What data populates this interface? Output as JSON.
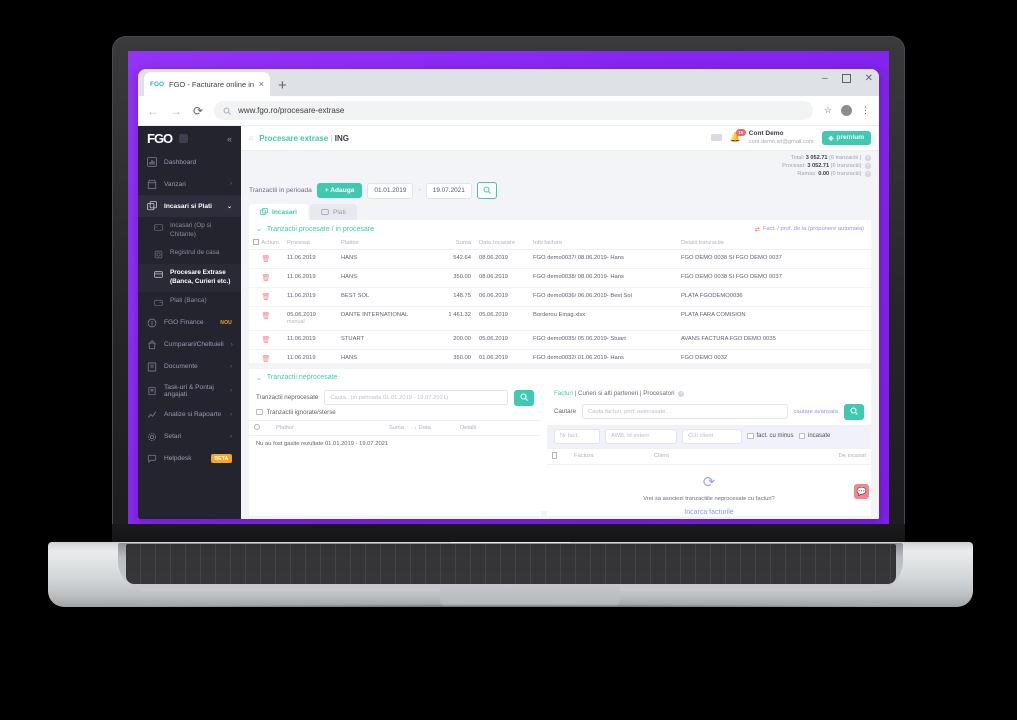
{
  "browser": {
    "tab_title": "FGO - Facturare online inte",
    "tab_close": "×",
    "new_tab": "+",
    "url": "www.fgo.ro/procesare-extrase",
    "back": "←",
    "forward": "→",
    "reload": "⟳",
    "star": "☆",
    "menu": "⋮",
    "minimize": "–",
    "close": "✕"
  },
  "sidebar": {
    "logo": "FGO",
    "collapse": "«",
    "items": [
      {
        "label": "Dashboard",
        "icon": "chart-icon",
        "chevron": ""
      },
      {
        "label": "Vanzari",
        "icon": "store-icon",
        "chevron": "›"
      },
      {
        "label": "Incasari si Plati",
        "icon": "layers-icon",
        "chevron": "⌄"
      }
    ],
    "sub_items": [
      {
        "label": "Incasari (Op si Chitante)",
        "icon": "card-icon"
      },
      {
        "label": "Registrul de casa",
        "icon": "safe-icon"
      },
      {
        "label": "Procesare Extrase (Banca, Curieri etc.)",
        "icon": "bank-icon"
      },
      {
        "label": "Plati (Banca)",
        "icon": "wallet-icon"
      }
    ],
    "items_after": [
      {
        "label": "FGO Finance",
        "icon": "coin-icon",
        "chevron": "",
        "badge": "NOU",
        "badge_style": "nou"
      },
      {
        "label": "Cumparari/Cheltuieli",
        "icon": "bag-icon",
        "chevron": "›"
      },
      {
        "label": "Documente",
        "icon": "doc-icon",
        "chevron": "›"
      },
      {
        "label": "Task-uri & Pontaj angajati",
        "icon": "badge-icon",
        "chevron": "›"
      },
      {
        "label": "Analize si Rapoarte",
        "icon": "graph-icon",
        "chevron": "›"
      },
      {
        "label": "Setari",
        "icon": "gear-icon",
        "chevron": "›"
      },
      {
        "label": "Helpdesk",
        "icon": "chat-icon",
        "chevron": "",
        "badge": "BETA",
        "badge_style": "beta"
      }
    ]
  },
  "topbar": {
    "home_icon": "home-icon",
    "breadcrumb": "Procesare extrase",
    "separator": "|",
    "bank": "ING",
    "bell_count": "19",
    "account_name": "Cont Demo",
    "account_email": "cont.demo.srl@gmail.com",
    "premium_label": "premium"
  },
  "totals": [
    {
      "label": "Total:",
      "value": "3 052.71",
      "note": "(6 tranzactii )"
    },
    {
      "label": "Procesat:",
      "value": "3 052.71",
      "note": "(6 tranzactii)"
    },
    {
      "label": "Ramas:",
      "value": "0.00",
      "note": "(0 tranzactii)"
    }
  ],
  "filterbar": {
    "label": "Tranzactii in perioada",
    "add_button": "+ Adauga",
    "date_from": "01.01.2019",
    "date_sep": "-",
    "date_to": "19.07.2021",
    "search_icon": "search-icon"
  },
  "view_tabs": [
    {
      "label": "Incasari",
      "icon": "incasari-icon",
      "active": true
    },
    {
      "label": "Plati",
      "icon": "plati-icon",
      "active": false
    }
  ],
  "processed": {
    "caret": "⌄",
    "title": "Tranzactii procesate / in procesare",
    "right_link": "Fact. / prof. de la (propunere automata)",
    "columns": [
      "Actiuni",
      "Procesat",
      "Platitor",
      "Suma",
      "Data Incasare",
      "Info factura",
      "Detalii tranzactie"
    ],
    "rows": [
      {
        "action": "delete-icon",
        "procesat": "11.06.2019",
        "procesat_sub": "",
        "platitor": "HANS",
        "suma": "542.64",
        "data": "08.06.2019",
        "info": "FGO demo0037/ 08.06.2019- Hans",
        "detalii": "FGO DEMO 0038 SI FGO DEMO 0037"
      },
      {
        "action": "delete-icon",
        "procesat": "11.06.2019",
        "procesat_sub": "",
        "platitor": "HANS",
        "suma": "350.00",
        "data": "08.06.2019",
        "info": "FGO demo0038/ 08.06.2019- Hans",
        "detalii": "FGO DEMO 0038 SI FGO DEMO 0037"
      },
      {
        "action": "delete-icon",
        "procesat": "11.06.2019",
        "procesat_sub": "",
        "platitor": "BEST SOL",
        "suma": "148.75",
        "data": "06.06.2019",
        "info": "FGO demo0036/ 06.06.2019- Best Sol",
        "detalii": "PLATA FGODEMO0036"
      },
      {
        "action": "delete-icon",
        "procesat": "05.06.2019",
        "procesat_sub": "manual",
        "platitor": "DANTE INTERNATIONAL",
        "suma": "1 461.32",
        "data": "05.06.2019",
        "info": "Borderou Emag.xlsx",
        "detalii": "PLATA FARA COMISION"
      },
      {
        "action": "delete-icon",
        "procesat": "11.06.2019",
        "procesat_sub": "",
        "platitor": "STUART",
        "suma": "200.00",
        "data": "05.06.2019",
        "info": "FGO demo0035/ 05.06.2019- Stuart",
        "detalii": "AVANS FACTURA FGO DEMO 0035"
      },
      {
        "action": "delete-icon",
        "procesat": "11.06.2019",
        "procesat_sub": "",
        "platitor": "HANS",
        "suma": "350.00",
        "data": "01.06.2019",
        "info": "FGO demo0032/ 01.06.2019- Hans",
        "detalii": "FGO DEMO 0032"
      }
    ]
  },
  "unprocessed": {
    "caret": "⌄",
    "title": "Tranzactii neprocesate",
    "search_label": "Tranzactii neprocesate",
    "search_placeholder": "Cauta...(in perioada 01.01.2019 - 19.07.2021)",
    "search_icon": "search-icon",
    "checkbox_label": "Tranzactii ignorate/sterse",
    "columns": [
      "Platitor",
      "Suma",
      "Data",
      "Detalii"
    ],
    "sort_arrow": "↓",
    "empty_message": "Nu au fost gasite rezultate 01.01.2019 - 19.07.2021"
  },
  "invoices": {
    "tab_facturi": "Facturi",
    "tab_curieri": "Curieri si alti parteneri",
    "tab_procesatori": "Procesatori",
    "sep": "|",
    "search_label": "Cautare",
    "search_placeholder": "Cauta facturi, prof. neincasate...",
    "advanced_link": "cautare avansata",
    "search_icon": "search-icon",
    "filters": [
      {
        "placeholder": "Nr fact."
      },
      {
        "placeholder": "AWB, id extern"
      },
      {
        "placeholder": "CUI client"
      }
    ],
    "checkboxes": [
      {
        "label": "fact. cu minus"
      },
      {
        "label": "incasate"
      }
    ],
    "columns": [
      "Factura",
      "Client",
      "De incasat"
    ],
    "refresh_icon": "refresh-icon",
    "empty_question": "Vrei sa asociezi tranzactiile neprocesate cu facturi?",
    "empty_link": "Incarca facturile"
  },
  "chat": {
    "icon": "chat-widget-icon"
  },
  "colors": {
    "accent": "#3ec9b0",
    "brand_purple": "#8B2FF0",
    "sidebar": "#24242f",
    "danger": "#f4848f",
    "link": "#8e94f0",
    "badge_orange": "#f5a623"
  }
}
